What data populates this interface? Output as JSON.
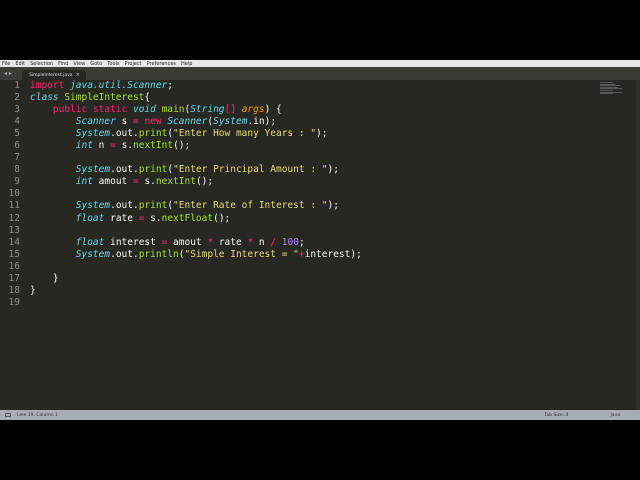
{
  "menu": [
    "File",
    "Edit",
    "Selection",
    "Find",
    "View",
    "Goto",
    "Tools",
    "Project",
    "Preferences",
    "Help"
  ],
  "tab": {
    "title": "SimpleInterest.java",
    "close": "×"
  },
  "nav_arrows": "◂ ▸",
  "code": [
    [
      [
        "kw",
        "import "
      ],
      [
        "st",
        "java.util.Scanner"
      ],
      [
        "pl",
        ";"
      ]
    ],
    [
      [
        "st",
        "class "
      ],
      [
        "cl",
        "SimpleInterest"
      ],
      [
        "pl",
        "{"
      ]
    ],
    [
      [
        "pl",
        "    "
      ],
      [
        "kw",
        "public static "
      ],
      [
        "st",
        "void "
      ],
      [
        "cl",
        "main"
      ],
      [
        "pl",
        "("
      ],
      [
        "st",
        "String"
      ],
      [
        "kw",
        "[] "
      ],
      [
        "arg",
        "args"
      ],
      [
        "pl",
        ") {"
      ]
    ],
    [
      [
        "pl",
        "        "
      ],
      [
        "st",
        "Scanner "
      ],
      [
        "pl",
        "s "
      ],
      [
        "op",
        "= "
      ],
      [
        "kw",
        "new "
      ],
      [
        "st",
        "Scanner"
      ],
      [
        "pl",
        "("
      ],
      [
        "st",
        "System"
      ],
      [
        "pl",
        ".in);"
      ]
    ],
    [
      [
        "pl",
        "        "
      ],
      [
        "st",
        "System"
      ],
      [
        "pl",
        ".out."
      ],
      [
        "cl",
        "print"
      ],
      [
        "pl",
        "("
      ],
      [
        "str",
        "\"Enter How many Years : \""
      ],
      [
        "pl",
        ");"
      ]
    ],
    [
      [
        "pl",
        "        "
      ],
      [
        "st",
        "int "
      ],
      [
        "pl",
        "n "
      ],
      [
        "op",
        "= "
      ],
      [
        "pl",
        "s."
      ],
      [
        "cl",
        "nextInt"
      ],
      [
        "pl",
        "();"
      ]
    ],
    [],
    [
      [
        "pl",
        "        "
      ],
      [
        "st",
        "System"
      ],
      [
        "pl",
        ".out."
      ],
      [
        "cl",
        "print"
      ],
      [
        "pl",
        "("
      ],
      [
        "str",
        "\"Enter Principal Amount : \""
      ],
      [
        "pl",
        ");"
      ]
    ],
    [
      [
        "pl",
        "        "
      ],
      [
        "st",
        "int "
      ],
      [
        "pl",
        "amout "
      ],
      [
        "op",
        "= "
      ],
      [
        "pl",
        "s."
      ],
      [
        "cl",
        "nextInt"
      ],
      [
        "pl",
        "();"
      ]
    ],
    [],
    [
      [
        "pl",
        "        "
      ],
      [
        "st",
        "System"
      ],
      [
        "pl",
        ".out."
      ],
      [
        "cl",
        "print"
      ],
      [
        "pl",
        "("
      ],
      [
        "str",
        "\"Enter Rate of Interest : \""
      ],
      [
        "pl",
        ");"
      ]
    ],
    [
      [
        "pl",
        "        "
      ],
      [
        "st",
        "float "
      ],
      [
        "pl",
        "rate "
      ],
      [
        "op",
        "= "
      ],
      [
        "pl",
        "s."
      ],
      [
        "cl",
        "nextFloat"
      ],
      [
        "pl",
        "();"
      ]
    ],
    [],
    [
      [
        "pl",
        "        "
      ],
      [
        "st",
        "float "
      ],
      [
        "pl",
        "interest "
      ],
      [
        "op",
        "= "
      ],
      [
        "pl",
        "amout "
      ],
      [
        "op",
        "* "
      ],
      [
        "pl",
        "rate "
      ],
      [
        "op",
        "* "
      ],
      [
        "pl",
        "n "
      ],
      [
        "op",
        "/ "
      ],
      [
        "num",
        "100"
      ],
      [
        "pl",
        ";"
      ]
    ],
    [
      [
        "pl",
        "        "
      ],
      [
        "st",
        "System"
      ],
      [
        "pl",
        ".out."
      ],
      [
        "cl",
        "println"
      ],
      [
        "pl",
        "("
      ],
      [
        "str",
        "\"Simple Interest = \""
      ],
      [
        "op",
        "+"
      ],
      [
        "pl",
        "interest);"
      ]
    ],
    [],
    [
      [
        "pl",
        "    }"
      ]
    ],
    [
      [
        "pl",
        "}"
      ]
    ],
    []
  ],
  "status": {
    "position": "Line 19, Column 1",
    "tab_size": "Tab Size: 4",
    "syntax": "Java"
  }
}
